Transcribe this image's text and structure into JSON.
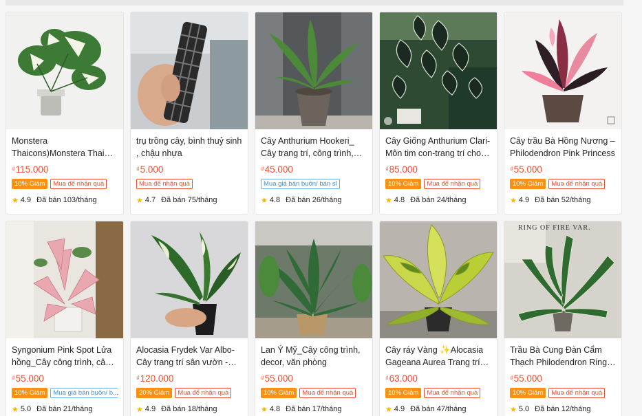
{
  "products": [
    {
      "title": "Monstera Thaicons)Monstera Thai Constellation siêu đẹp",
      "currency": "₫",
      "price": "115.000",
      "badges": [
        {
          "text": "10% Giảm",
          "kind": "disc"
        },
        {
          "text": "Mua để nhận quà",
          "kind": "red"
        }
      ],
      "rating": "4.9",
      "sold": "Đã bán 103/tháng",
      "image": "monstera-variegata-icon"
    },
    {
      "title": "trụ trồng cây, bình thuỷ sinh , chậu nhựa",
      "currency": "₫",
      "price": "5.000",
      "badges": [
        {
          "text": "Mua để nhận quà",
          "kind": "red"
        }
      ],
      "rating": "4.7",
      "sold": "Đã bán 75/tháng",
      "image": "plastic-pole-icon"
    },
    {
      "title": "Cây Anthurium Hookeri_ Cây trang trí, công trình, văn phòng",
      "currency": "₫",
      "price": "45.000",
      "badges": [
        {
          "text": "Mua giá bán buôn/ bán sỉ",
          "kind": "blue"
        }
      ],
      "rating": "4.8",
      "sold": "Đã bán 26/tháng",
      "image": "anthurium-hookeri-icon"
    },
    {
      "title": "Cây Giống Anthurium Clari- Môn tim con-trang trí cho phòng",
      "currency": "₫",
      "price": "85.000",
      "badges": [
        {
          "text": "10% Giảm",
          "kind": "disc"
        },
        {
          "text": "Mua để nhận quà",
          "kind": "red"
        }
      ],
      "rating": "4.8",
      "sold": "Đã bán 24/tháng",
      "image": "anthurium-clarinervium-icon"
    },
    {
      "title": "Cây trầu Bà Hồng Nương – Philodendron Pink Princess",
      "currency": "₫",
      "price": "55.000",
      "badges": [
        {
          "text": "10% Giảm",
          "kind": "disc"
        },
        {
          "text": "Mua để nhận quà",
          "kind": "red"
        }
      ],
      "rating": "4.9",
      "sold": "Đã bán 52/tháng",
      "image": "pink-princess-icon"
    },
    {
      "title": "Syngonium Pink Spot Lửa hồng_Cây công trình, cây cảnh",
      "currency": "₫",
      "price": "55.000",
      "badges": [
        {
          "text": "10% Giảm",
          "kind": "disc"
        },
        {
          "text": "Mua giá bán buôn/ b...",
          "kind": "blue"
        }
      ],
      "rating": "5.0",
      "sold": "Đã bán 21/tháng",
      "image": "syngonium-pink-icon"
    },
    {
      "title": "Alocasia Frydek Var Albo- Cây trang trí sân vườn - văn phòng",
      "currency": "₫",
      "price": "120.000",
      "badges": [
        {
          "text": "20% Giảm",
          "kind": "disc"
        },
        {
          "text": "Mua để nhận quà",
          "kind": "red"
        }
      ],
      "rating": "4.9",
      "sold": "Đã bán 18/tháng",
      "image": "alocasia-frydek-icon"
    },
    {
      "title": "Lan Ý Mỹ_Cây công trình, decor, văn phòng",
      "currency": "₫",
      "price": "55.000",
      "badges": [
        {
          "text": "10% Giảm",
          "kind": "disc"
        },
        {
          "text": "Mua để nhận quà",
          "kind": "red"
        }
      ],
      "rating": "4.8",
      "sold": "Đã bán 17/tháng",
      "image": "peace-lily-icon"
    },
    {
      "title": "Cây ráy Vàng ✨Alocasia Gageana Aurea Trang trí sân vườn",
      "currency": "₫",
      "price": "63.000",
      "badges": [
        {
          "text": "10% Giảm",
          "kind": "disc"
        },
        {
          "text": "Mua để nhận quà",
          "kind": "red"
        }
      ],
      "rating": "4.9",
      "sold": "Đã bán 47/tháng",
      "image": "alocasia-aurea-icon"
    },
    {
      "title": "Trầu Bà Cung Đàn Cẩm Thạch Philodendron Ring of Fire",
      "currency": "₫",
      "price": "55.000",
      "badges": [
        {
          "text": "10% Giảm",
          "kind": "disc"
        },
        {
          "text": "Mua để nhận quà",
          "kind": "red"
        }
      ],
      "rating": "5.0",
      "sold": "Đã bán 12/tháng",
      "image": "ring-of-fire-icon",
      "watermark": "RING OF FIRE VAR."
    }
  ]
}
